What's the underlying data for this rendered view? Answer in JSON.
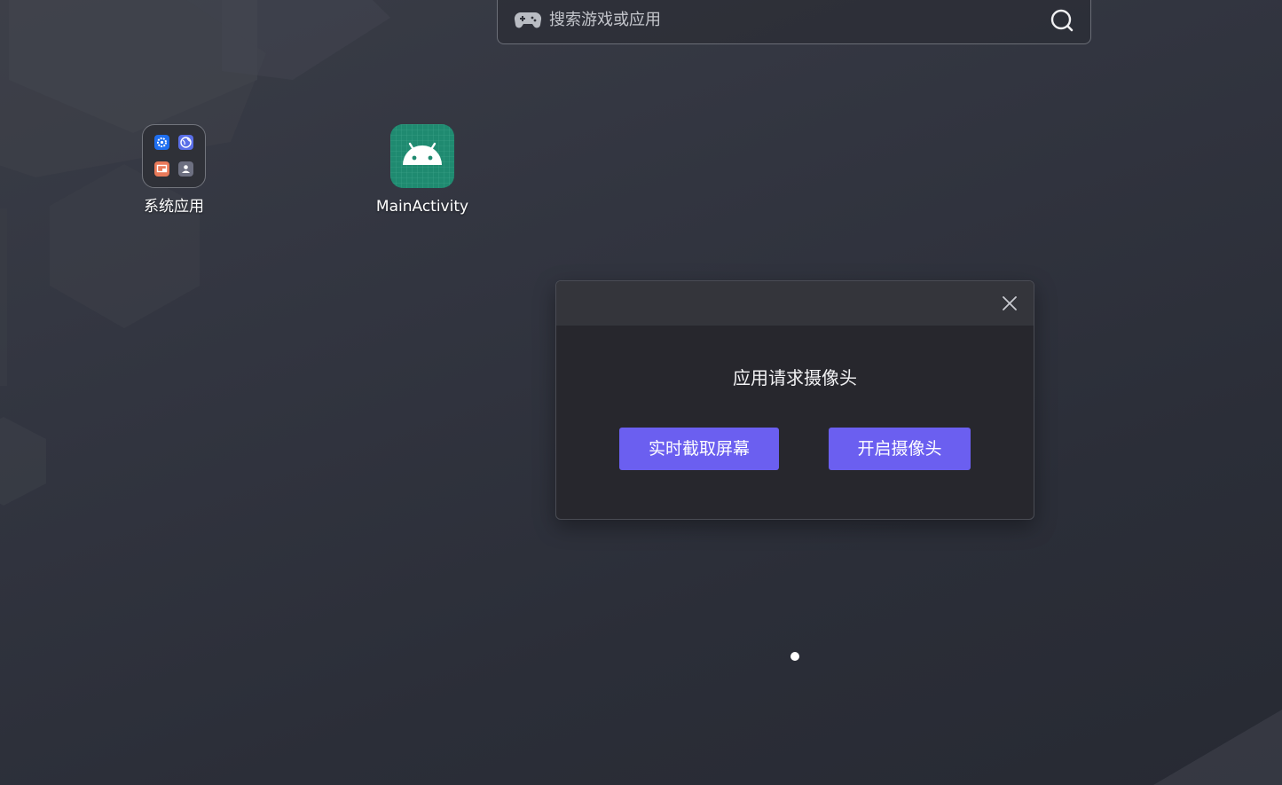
{
  "search": {
    "placeholder": "搜索游戏或应用",
    "left_icon": "gamepad-icon",
    "right_icon": "search-icon"
  },
  "desktop": {
    "icons": [
      {
        "label": "系统应用",
        "icon": "folder-icon",
        "contents": [
          "settings-icon",
          "browser-icon",
          "file-manager-icon",
          "contacts-icon"
        ]
      },
      {
        "label": "MainActivity",
        "icon": "android-icon"
      }
    ]
  },
  "dialog": {
    "message": "应用请求摄像头",
    "close_icon": "close-icon",
    "buttons": {
      "screen_capture": "实时截取屏幕",
      "open_camera": "开启摄像头"
    }
  },
  "pager": {
    "pages": 1,
    "current": 1
  },
  "colors": {
    "accent": "#6b5ff0",
    "dialog_bg": "#27272d",
    "dialog_header": "#34353b",
    "android_tile": "#1f8a70"
  }
}
